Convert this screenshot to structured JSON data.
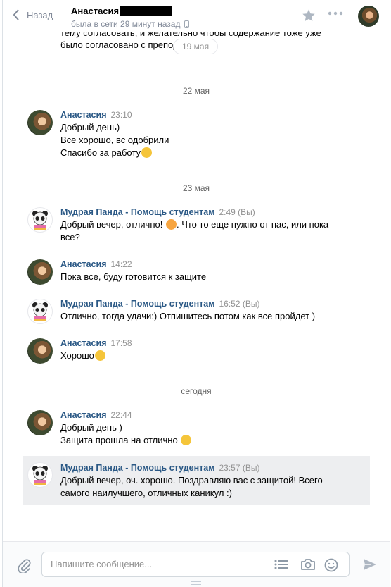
{
  "header": {
    "back_label": "Назад",
    "peer_name": "Анастасия",
    "peer_status": "была в сети 29 минут назад"
  },
  "history": {
    "cut_message_text": "тему согласовать, и желательно чтобы содержание тоже уже было согласовано с преподав.",
    "floating_date": "19 мая",
    "dates": [
      "22 мая",
      "23 мая",
      "сегодня"
    ],
    "messages": [
      {
        "author": "Анастасия",
        "time": "23:10",
        "lines": [
          "Добрый день)",
          "Все хорошо, вс одобрили",
          "Спасибо за работу"
        ],
        "avatar": "girl"
      },
      {
        "author": "Мудрая Панда - Помощь студентам",
        "time": "2:49 (Вы)",
        "lines": [
          "Добрый вечер, отлично! ",
          ". Что то еще нужно от нас, или пока",
          "все?"
        ],
        "avatar": "panda"
      },
      {
        "author": "Анастасия",
        "time": "14:22",
        "lines": [
          "Пока все, буду готовится к защите"
        ],
        "avatar": "girl"
      },
      {
        "author": "Мудрая Панда - Помощь студентам",
        "time": "16:52 (Вы)",
        "lines": [
          "Отлично, тогда удачи:) Отпишитесь потом как все пройдет )"
        ],
        "avatar": "panda"
      },
      {
        "author": "Анастасия",
        "time": "17:58",
        "lines": [
          "Хорошо"
        ],
        "avatar": "girl"
      },
      {
        "author": "Анастасия",
        "time": "22:44",
        "lines": [
          "Добрый день )",
          "Защита прошла на отлично "
        ],
        "avatar": "girl"
      },
      {
        "author": "Мудрая Панда - Помощь студентам",
        "time": "23:57 (Вы)",
        "lines": [
          "Добрый вечер, оч. хорошо. Поздравляю вас с защитой! Всего",
          "самого наилучшего, отличных каникул :)"
        ],
        "avatar": "panda"
      }
    ]
  },
  "composer": {
    "placeholder": "Напишите сообщение..."
  },
  "colors": {
    "link": "#2a5885",
    "muted": "#939393",
    "selected_bg": "#edeef0"
  },
  "icons": [
    "back-chevron-icon",
    "star-icon",
    "more-icon",
    "phone-icon",
    "paperclip-icon",
    "template-list-icon",
    "camera-icon",
    "smile-icon",
    "send-icon"
  ]
}
